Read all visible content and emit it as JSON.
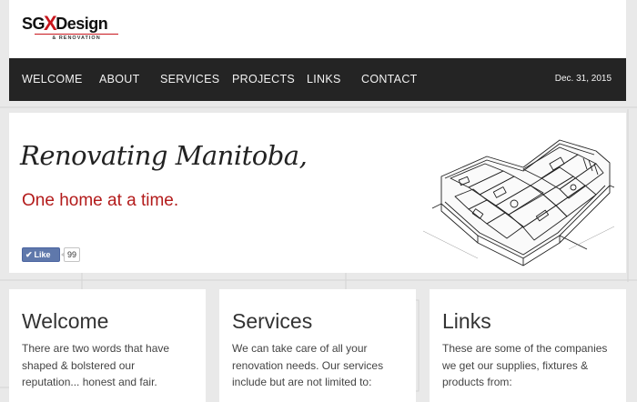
{
  "logo": {
    "part1": "SG",
    "part2": "X",
    "part3": "Design",
    "tagline": "& RENOVATION"
  },
  "nav": {
    "items": [
      "WELCOME",
      "ABOUT",
      "SERVICES",
      "PROJECTS",
      "LINKS",
      "CONTACT"
    ],
    "date": "Dec. 31, 2015"
  },
  "hero": {
    "headline": "Renovating Manitoba,",
    "subheadline": "One home at a time.",
    "like_label": "Like",
    "like_count": "99"
  },
  "cards": [
    {
      "title": "Welcome",
      "body": "There are two words that have shaped & bolstered our reputation... honest and fair."
    },
    {
      "title": "Services",
      "body": "We can take care of all your renovation needs. Our services include but are not limited to:"
    },
    {
      "title": "Links",
      "body": "These are some of the companies we get our supplies, fixtures & products from:"
    }
  ],
  "colors": {
    "accent": "#c8161d",
    "nav_bg": "#242424",
    "subheadline": "#b31b1b",
    "facebook": "#5f78ab"
  },
  "icons": [
    "thumbs-up-icon",
    "house-blueprint-illustration"
  ]
}
